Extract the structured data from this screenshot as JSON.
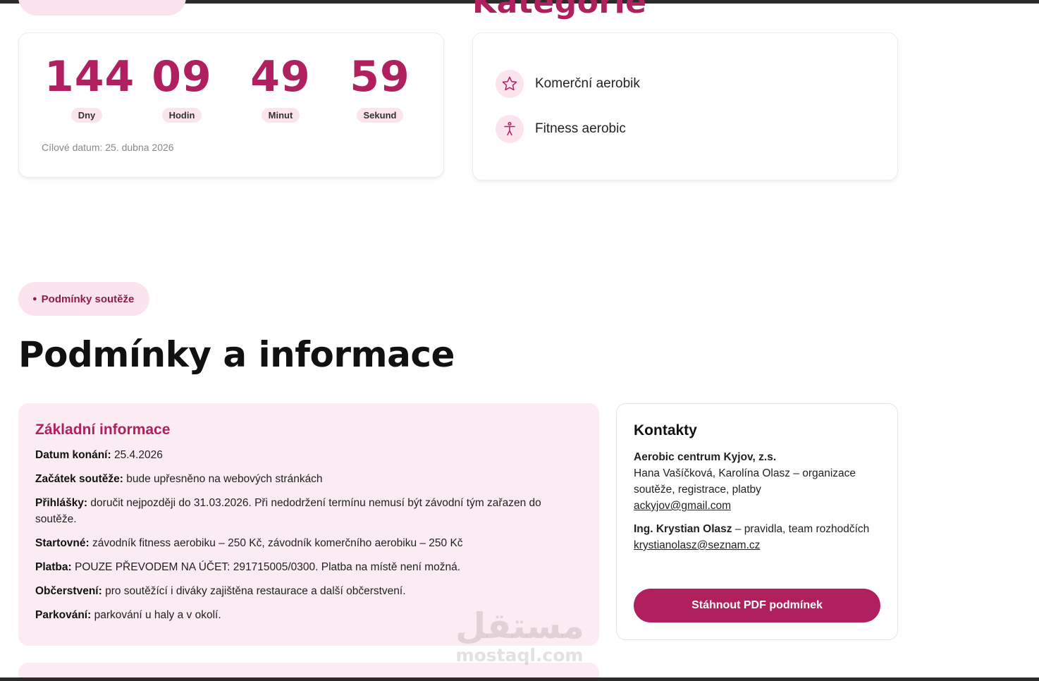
{
  "categories_section": {
    "heading": "Kategorie"
  },
  "countdown": {
    "units": [
      {
        "value": "144",
        "label": "Dny"
      },
      {
        "value": "09",
        "label": "Hodin"
      },
      {
        "value": "49",
        "label": "Minut"
      },
      {
        "value": "59",
        "label": "Sekund"
      }
    ],
    "target_date": "Cílové datum: 25. dubna 2026"
  },
  "categories": {
    "items": [
      {
        "label": "Komerční aerobik",
        "icon": "star-icon"
      },
      {
        "label": "Fitness aerobic",
        "icon": "person-icon"
      }
    ]
  },
  "conditions": {
    "badge": "Podmínky soutěže",
    "title": "Podmínky a informace"
  },
  "basic_info": {
    "heading": "Základní informace",
    "rows": [
      {
        "key": "Datum konání:",
        "value": " 25.4.2026"
      },
      {
        "key": "Začátek soutěže:",
        "value": " bude upřesněno na webových stránkách"
      },
      {
        "key": "Přihlášky:",
        "value": " doručit nejpozději do 31.03.2026. Při nedodržení termínu nemusí být závodní tým zařazen do soutěže."
      },
      {
        "key": "Startovné:",
        "value": " závodník fitness aerobiku – 250 Kč, závodník komerčního aerobiku – 250 Kč"
      },
      {
        "key": "Platba:",
        "value": " POUZE PŘEVODEM NA ÚČET: 291715005/0300. Platba na místě není možná."
      },
      {
        "key": "Občerstvení:",
        "value": " pro soutěžící i diváky zajištěna restaurace a další občerstvení."
      },
      {
        "key": "Parkování:",
        "value": " parkování u haly a v okolí."
      }
    ]
  },
  "contacts": {
    "heading": "Kontakty",
    "org_name": "Aerobic centrum Kyjov, z.s.",
    "org_people": "Hana Vašíčková, Karolína Olasz – organizace soutěže, registrace, platby",
    "org_email": "ackyjov@gmail.com",
    "person_name": "Ing. Krystian Olasz",
    "person_role": " – pravidla, team rozhodčích",
    "person_email": "krystianolasz@seznam.cz",
    "pdf_button": "Stáhnout PDF podmínek"
  },
  "watermark": {
    "arabic": "مستقل",
    "latin": "mostaql.com"
  },
  "colors": {
    "accent": "#b0205f",
    "soft_pink": "#fbe4ee",
    "panel_pink": "#fbebf2"
  }
}
